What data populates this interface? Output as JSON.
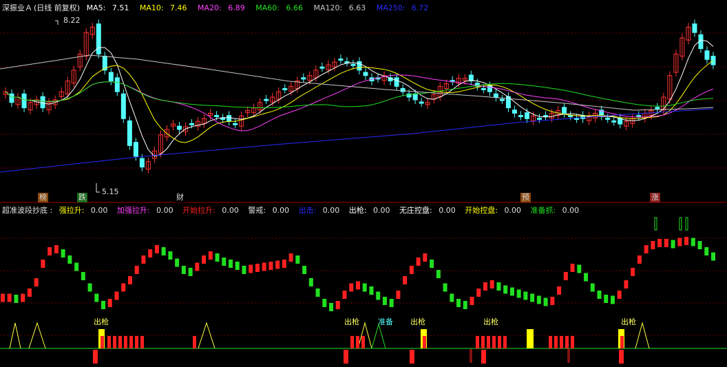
{
  "top_header": {
    "stock": "深振业Ａ",
    "period": "(日线 前复权)",
    "ma": [
      {
        "label": "MA5:",
        "value": "7.51",
        "color": "#ffffff"
      },
      {
        "label": "MA10:",
        "value": "7.46",
        "color": "#ffff00"
      },
      {
        "label": "MA20:",
        "value": "6.89",
        "color": "#ff40ff"
      },
      {
        "label": "MA60:",
        "value": "6.66",
        "color": "#20e020"
      },
      {
        "label": "MA120:",
        "value": "6.63",
        "color": "#c8c8c8"
      },
      {
        "label": "MA250:",
        "value": "6.72",
        "color": "#2a2aff"
      }
    ]
  },
  "price_labels": {
    "high": "8.22",
    "low": "5.15"
  },
  "event_tags": [
    {
      "text": "榜",
      "bg": "#8a4a10"
    },
    {
      "text": "跌",
      "bg": "#1d6b1d"
    },
    {
      "text": "财",
      "bg": "#000000"
    },
    {
      "text": "预",
      "bg": "#8a4a10"
    },
    {
      "text": "涨",
      "bg": "#8a1a1a"
    }
  ],
  "indicator_header": {
    "name": "超准波段抄底",
    "items": [
      {
        "label": "强拉升:",
        "value": "0.00",
        "color": "#ffff00"
      },
      {
        "label": "加强拉升:",
        "value": "0.00",
        "color": "#ff40ff"
      },
      {
        "label": "开始拉升:",
        "value": "0.00",
        "color": "#ff2020"
      },
      {
        "label": "警戒:",
        "value": "0.00",
        "color": "#e0e0e0"
      },
      {
        "label": "出击:",
        "value": "0.00",
        "color": "#2a2aff"
      },
      {
        "label": "出枪:",
        "value": "0.00",
        "color": "#ffffff"
      },
      {
        "label": "无庄控盘:",
        "value": "0.00",
        "color": "#ffffff"
      },
      {
        "label": "开始控盘:",
        "value": "0.00",
        "color": "#ffff00"
      },
      {
        "label": "准备抓:",
        "value": "0.00",
        "color": "#20e020"
      }
    ]
  },
  "signal_labels": [
    "出枪",
    "出枪",
    "准备",
    "出枪",
    "出枪",
    "出枪"
  ],
  "colors": {
    "up": "#ff3232",
    "down": "#54ffff",
    "grid": "#7a0000",
    "osc_up": "#ff2020",
    "osc_down": "#20e020"
  }
}
